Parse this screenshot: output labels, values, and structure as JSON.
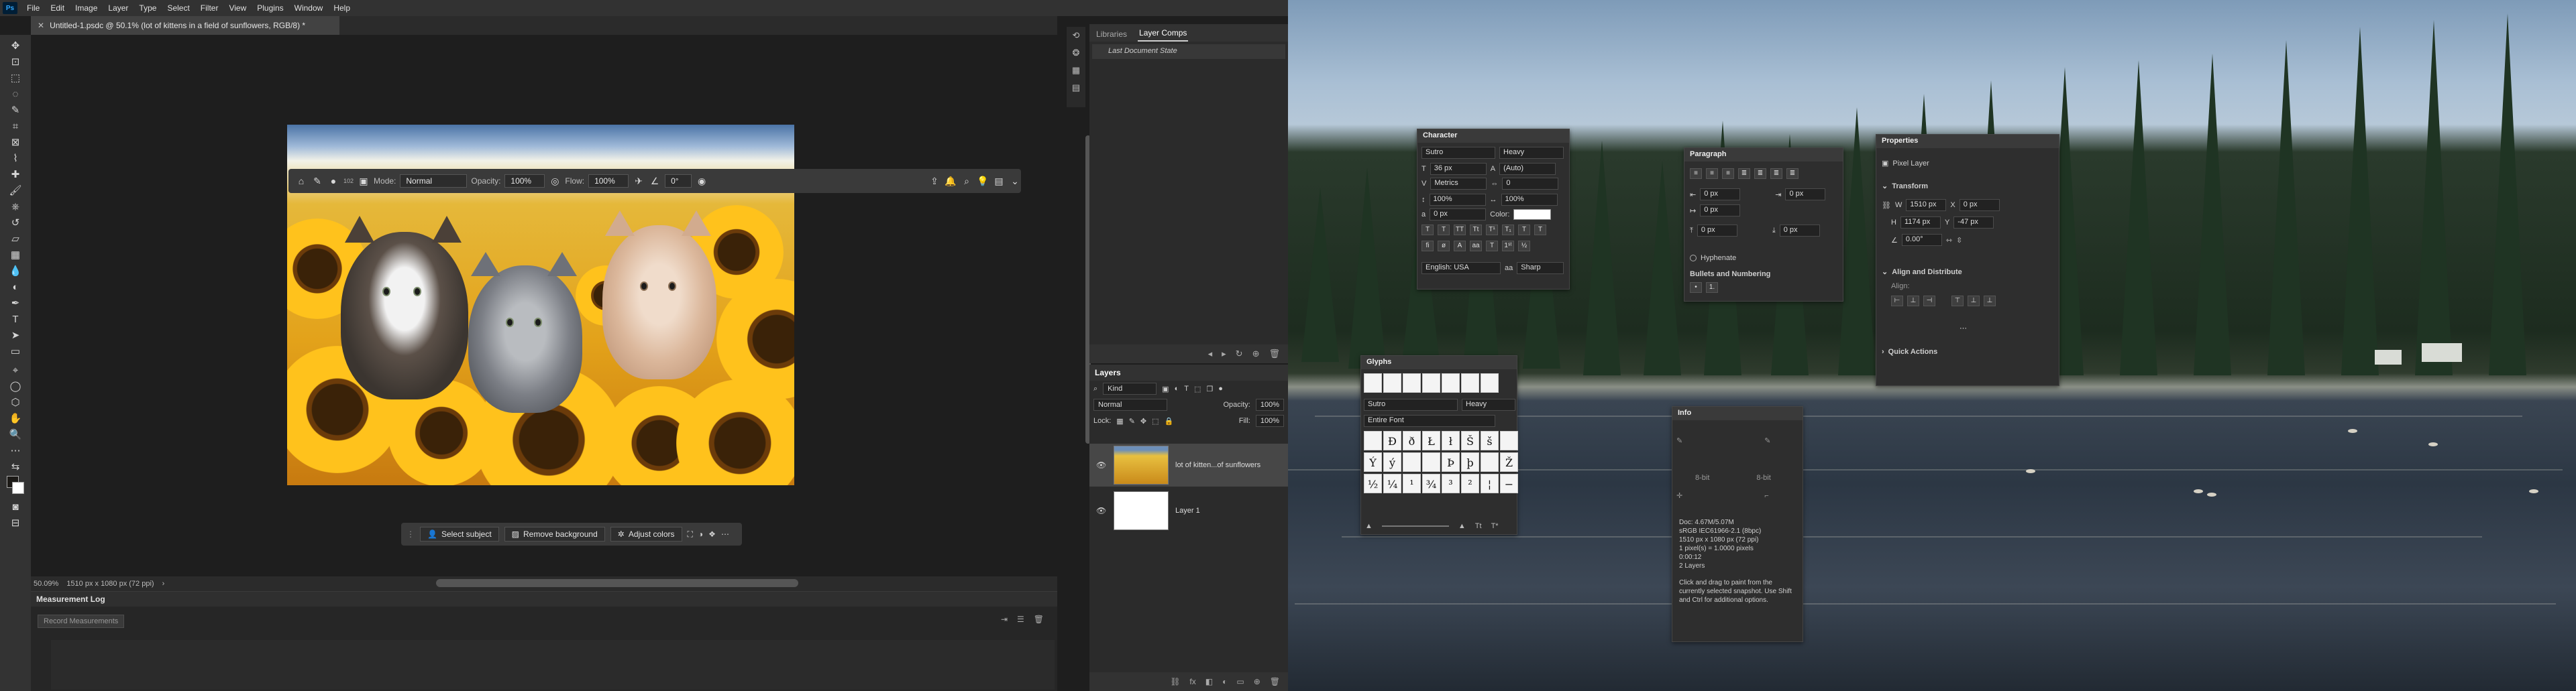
{
  "ps": {
    "menu": [
      "File",
      "Edit",
      "Image",
      "Layer",
      "Type",
      "Select",
      "Filter",
      "View",
      "Plugins",
      "Window",
      "Help"
    ],
    "doc_tab": "Untitled-1.psdc @ 50.1% (lot of kittens in a field of sunflowers, RGB/8) *",
    "context": {
      "mode_label": "Mode:",
      "mode_value": "Normal",
      "opacity_label": "Opacity:",
      "opacity_value": "100%",
      "flow_label": "Flow:",
      "flow_value": "100%",
      "angle_value": "0°",
      "brush_size": "102"
    },
    "tasks": {
      "select_subject": "Select subject",
      "remove_background": "Remove background",
      "adjust_colors": "Adjust colors"
    },
    "status": {
      "zoom": "50.09%",
      "dims": "1510 px x 1080 px (72 ppi)"
    },
    "measurement": {
      "title": "Measurement Log",
      "record_button": "Record Measurements"
    },
    "panels": {
      "tab_libraries": "Libraries",
      "tab_layer_comps": "Layer Comps",
      "last_doc_state": "Last Document State",
      "layers_title": "Layers",
      "kind_label": "Kind",
      "blend_mode": "Normal",
      "opacity_label": "Opacity:",
      "opacity_value": "100%",
      "lock_label": "Lock:",
      "fill_label": "Fill:",
      "fill_value": "100%",
      "layers": [
        {
          "name": "lot of kitten...of sunflowers"
        },
        {
          "name": "Layer 1"
        }
      ]
    },
    "colors": {
      "accent": "#31a8ff",
      "panel": "#2b2b2b",
      "menubar": "#323232"
    }
  },
  "character": {
    "title": "Character",
    "font_family": "Sutro",
    "font_style": "Heavy",
    "size": "36 px",
    "leading": "(Auto)",
    "kerning": "Metrics",
    "tracking": "0",
    "vscale": "100%",
    "hscale": "100%",
    "baseline": "0 px",
    "color_label": "Color:",
    "language": "English: USA",
    "aa_label": "aa",
    "antialias": "Sharp"
  },
  "paragraph": {
    "title": "Paragraph",
    "indent_left": "0 px",
    "indent_right": "0 px",
    "indent_first": "0 px",
    "space_before": "0 px",
    "space_after": "0 px",
    "hyphenate": "Hyphenate",
    "bullets": "Bullets and Numbering"
  },
  "properties": {
    "title": "Properties",
    "kind": "Pixel Layer",
    "transform": "Transform",
    "w_label": "W",
    "w_value": "1510 px",
    "h_label": "H",
    "h_value": "1174 px",
    "x_label": "X",
    "x_value": "0 px",
    "y_label": "Y",
    "y_value": "-47 px",
    "angle_value": "0.00°",
    "align_distribute": "Align and Distribute",
    "align_label": "Align:",
    "quick_actions": "Quick Actions"
  },
  "glyphs": {
    "title": "Glyphs",
    "font_family": "Sutro",
    "font_style": "Heavy",
    "show": "Entire Font",
    "chars": [
      "Ð",
      "ð",
      "Ł",
      "ł",
      "Š",
      "š",
      "Ý",
      "ý",
      "Þ",
      "þ",
      "Ž",
      "½",
      "¼",
      "¹",
      "¾",
      "³",
      "²",
      "¦",
      "−"
    ]
  },
  "info": {
    "title": "Info",
    "bitdepth_a": "8-bit",
    "bitdepth_b": "8-bit",
    "doc": "Doc: 4.67M/5.07M",
    "profile": "sRGB IEC61966-2.1 (8bpc)",
    "dims": "1510 px x 1080 px (72 ppi)",
    "scale": "1 pixel(s) = 1.0000 pixels",
    "time": "0:00:12",
    "layers": "2 Layers",
    "hint": "Click and drag to paint from the currently selected snapshot. Use Shift and Ctrl for additional options."
  }
}
